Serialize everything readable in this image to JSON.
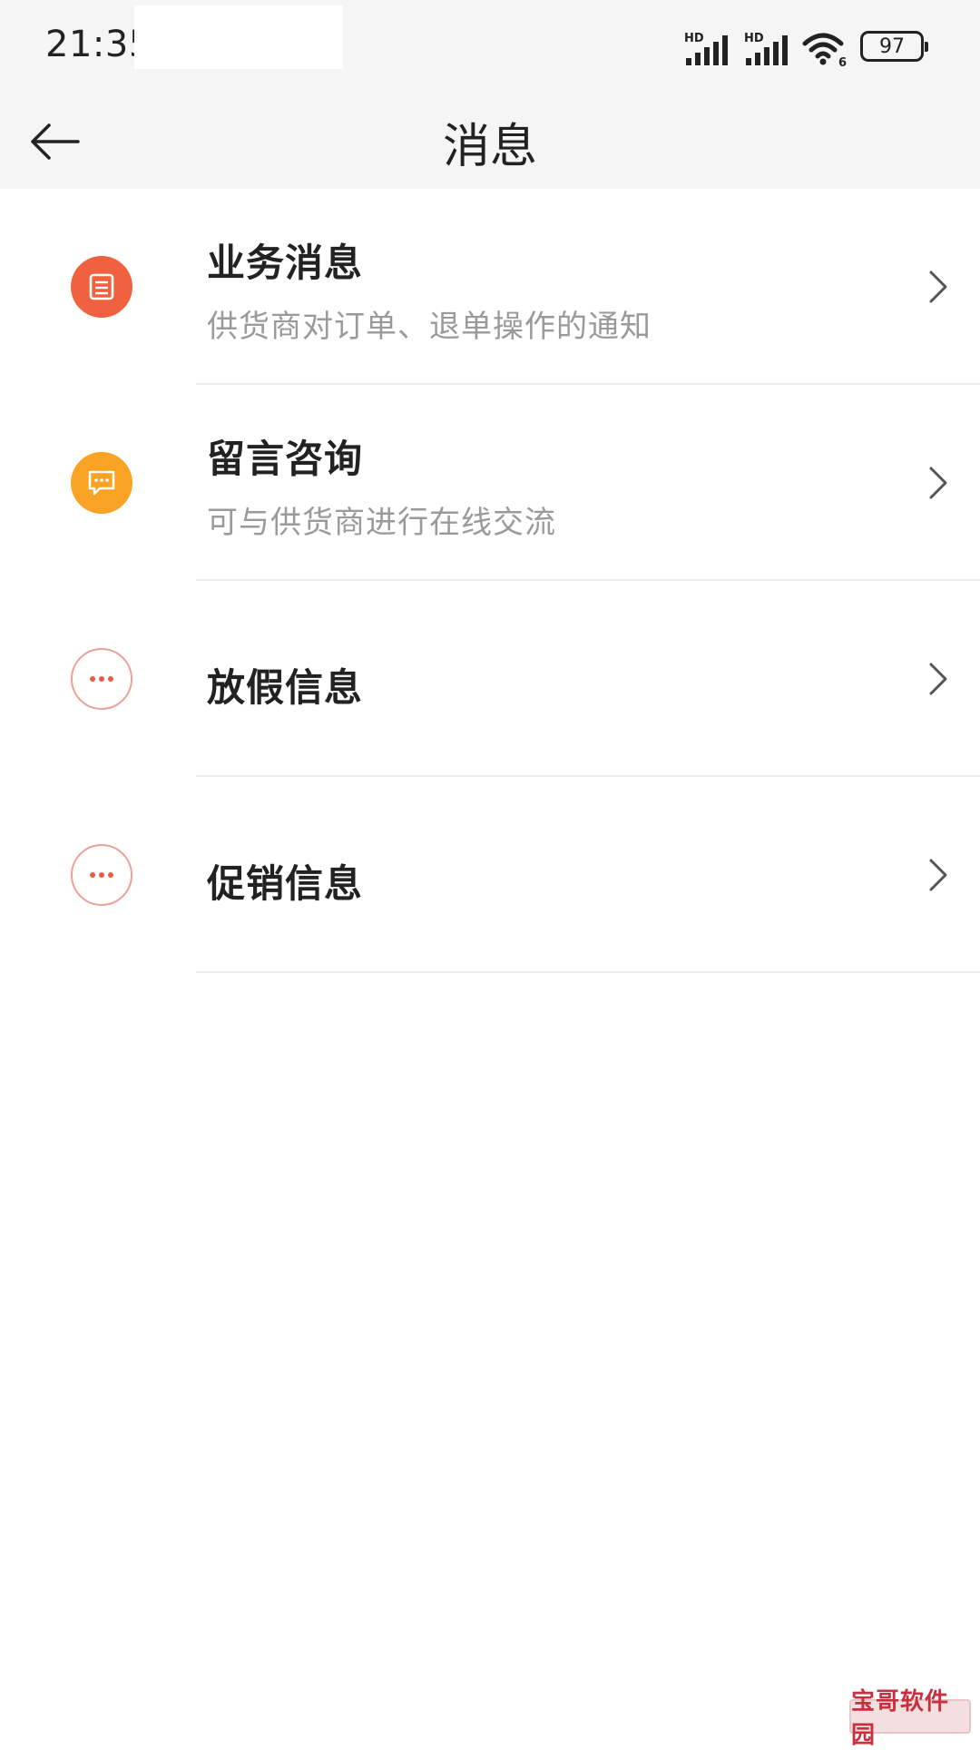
{
  "status_bar": {
    "time": "21:35",
    "signal1_label": "HD",
    "signal2_label": "HD",
    "wifi_badge": "6",
    "battery": "97"
  },
  "header": {
    "title": "消息",
    "back_icon": "arrow-left-icon"
  },
  "accent_colors": {
    "business": "#f0623f",
    "consult": "#f9a324",
    "outline": "#eaa197"
  },
  "items": [
    {
      "title": "业务消息",
      "subtitle": "供货商对订单、退单操作的通知",
      "icon": "document-icon"
    },
    {
      "title": "留言咨询",
      "subtitle": "可与供货商进行在线交流",
      "icon": "chat-bubble-icon"
    },
    {
      "title": "放假信息",
      "subtitle": "",
      "icon": "more-dots-icon"
    },
    {
      "title": "促销信息",
      "subtitle": "",
      "icon": "more-dots-icon"
    }
  ],
  "watermark": "宝哥软件园"
}
